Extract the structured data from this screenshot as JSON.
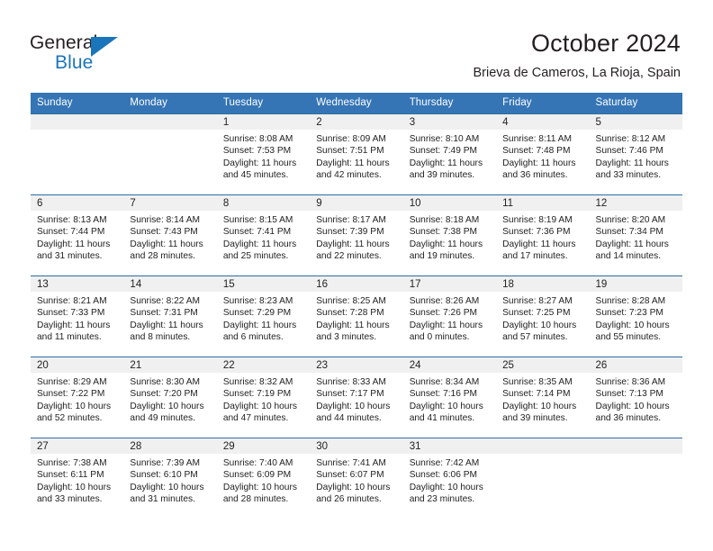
{
  "logo": {
    "word_top": "General",
    "word_bottom": "Blue",
    "triangle_color": "#1b75bb"
  },
  "header": {
    "title": "October 2024",
    "subtitle": "Brieva de Cameros, La Rioja, Spain"
  },
  "colors": {
    "header_row": "#3575b5",
    "row_border": "#2e6da4",
    "daynum_band": "#f0f0f0",
    "text": "#222222"
  },
  "weekday_headers": [
    "Sunday",
    "Monday",
    "Tuesday",
    "Wednesday",
    "Thursday",
    "Friday",
    "Saturday"
  ],
  "labels": {
    "sunrise_prefix": "Sunrise: ",
    "sunset_prefix": "Sunset: ",
    "daylight_prefix": "Daylight: "
  },
  "weeks": [
    [
      {
        "day": "",
        "sunrise": "",
        "sunset": "",
        "daylight_a": "",
        "daylight_b": ""
      },
      {
        "day": "",
        "sunrise": "",
        "sunset": "",
        "daylight_a": "",
        "daylight_b": ""
      },
      {
        "day": "1",
        "sunrise": "Sunrise: 8:08 AM",
        "sunset": "Sunset: 7:53 PM",
        "daylight_a": "Daylight: 11 hours",
        "daylight_b": "and 45 minutes."
      },
      {
        "day": "2",
        "sunrise": "Sunrise: 8:09 AM",
        "sunset": "Sunset: 7:51 PM",
        "daylight_a": "Daylight: 11 hours",
        "daylight_b": "and 42 minutes."
      },
      {
        "day": "3",
        "sunrise": "Sunrise: 8:10 AM",
        "sunset": "Sunset: 7:49 PM",
        "daylight_a": "Daylight: 11 hours",
        "daylight_b": "and 39 minutes."
      },
      {
        "day": "4",
        "sunrise": "Sunrise: 8:11 AM",
        "sunset": "Sunset: 7:48 PM",
        "daylight_a": "Daylight: 11 hours",
        "daylight_b": "and 36 minutes."
      },
      {
        "day": "5",
        "sunrise": "Sunrise: 8:12 AM",
        "sunset": "Sunset: 7:46 PM",
        "daylight_a": "Daylight: 11 hours",
        "daylight_b": "and 33 minutes."
      }
    ],
    [
      {
        "day": "6",
        "sunrise": "Sunrise: 8:13 AM",
        "sunset": "Sunset: 7:44 PM",
        "daylight_a": "Daylight: 11 hours",
        "daylight_b": "and 31 minutes."
      },
      {
        "day": "7",
        "sunrise": "Sunrise: 8:14 AM",
        "sunset": "Sunset: 7:43 PM",
        "daylight_a": "Daylight: 11 hours",
        "daylight_b": "and 28 minutes."
      },
      {
        "day": "8",
        "sunrise": "Sunrise: 8:15 AM",
        "sunset": "Sunset: 7:41 PM",
        "daylight_a": "Daylight: 11 hours",
        "daylight_b": "and 25 minutes."
      },
      {
        "day": "9",
        "sunrise": "Sunrise: 8:17 AM",
        "sunset": "Sunset: 7:39 PM",
        "daylight_a": "Daylight: 11 hours",
        "daylight_b": "and 22 minutes."
      },
      {
        "day": "10",
        "sunrise": "Sunrise: 8:18 AM",
        "sunset": "Sunset: 7:38 PM",
        "daylight_a": "Daylight: 11 hours",
        "daylight_b": "and 19 minutes."
      },
      {
        "day": "11",
        "sunrise": "Sunrise: 8:19 AM",
        "sunset": "Sunset: 7:36 PM",
        "daylight_a": "Daylight: 11 hours",
        "daylight_b": "and 17 minutes."
      },
      {
        "day": "12",
        "sunrise": "Sunrise: 8:20 AM",
        "sunset": "Sunset: 7:34 PM",
        "daylight_a": "Daylight: 11 hours",
        "daylight_b": "and 14 minutes."
      }
    ],
    [
      {
        "day": "13",
        "sunrise": "Sunrise: 8:21 AM",
        "sunset": "Sunset: 7:33 PM",
        "daylight_a": "Daylight: 11 hours",
        "daylight_b": "and 11 minutes."
      },
      {
        "day": "14",
        "sunrise": "Sunrise: 8:22 AM",
        "sunset": "Sunset: 7:31 PM",
        "daylight_a": "Daylight: 11 hours",
        "daylight_b": "and 8 minutes."
      },
      {
        "day": "15",
        "sunrise": "Sunrise: 8:23 AM",
        "sunset": "Sunset: 7:29 PM",
        "daylight_a": "Daylight: 11 hours",
        "daylight_b": "and 6 minutes."
      },
      {
        "day": "16",
        "sunrise": "Sunrise: 8:25 AM",
        "sunset": "Sunset: 7:28 PM",
        "daylight_a": "Daylight: 11 hours",
        "daylight_b": "and 3 minutes."
      },
      {
        "day": "17",
        "sunrise": "Sunrise: 8:26 AM",
        "sunset": "Sunset: 7:26 PM",
        "daylight_a": "Daylight: 11 hours",
        "daylight_b": "and 0 minutes."
      },
      {
        "day": "18",
        "sunrise": "Sunrise: 8:27 AM",
        "sunset": "Sunset: 7:25 PM",
        "daylight_a": "Daylight: 10 hours",
        "daylight_b": "and 57 minutes."
      },
      {
        "day": "19",
        "sunrise": "Sunrise: 8:28 AM",
        "sunset": "Sunset: 7:23 PM",
        "daylight_a": "Daylight: 10 hours",
        "daylight_b": "and 55 minutes."
      }
    ],
    [
      {
        "day": "20",
        "sunrise": "Sunrise: 8:29 AM",
        "sunset": "Sunset: 7:22 PM",
        "daylight_a": "Daylight: 10 hours",
        "daylight_b": "and 52 minutes."
      },
      {
        "day": "21",
        "sunrise": "Sunrise: 8:30 AM",
        "sunset": "Sunset: 7:20 PM",
        "daylight_a": "Daylight: 10 hours",
        "daylight_b": "and 49 minutes."
      },
      {
        "day": "22",
        "sunrise": "Sunrise: 8:32 AM",
        "sunset": "Sunset: 7:19 PM",
        "daylight_a": "Daylight: 10 hours",
        "daylight_b": "and 47 minutes."
      },
      {
        "day": "23",
        "sunrise": "Sunrise: 8:33 AM",
        "sunset": "Sunset: 7:17 PM",
        "daylight_a": "Daylight: 10 hours",
        "daylight_b": "and 44 minutes."
      },
      {
        "day": "24",
        "sunrise": "Sunrise: 8:34 AM",
        "sunset": "Sunset: 7:16 PM",
        "daylight_a": "Daylight: 10 hours",
        "daylight_b": "and 41 minutes."
      },
      {
        "day": "25",
        "sunrise": "Sunrise: 8:35 AM",
        "sunset": "Sunset: 7:14 PM",
        "daylight_a": "Daylight: 10 hours",
        "daylight_b": "and 39 minutes."
      },
      {
        "day": "26",
        "sunrise": "Sunrise: 8:36 AM",
        "sunset": "Sunset: 7:13 PM",
        "daylight_a": "Daylight: 10 hours",
        "daylight_b": "and 36 minutes."
      }
    ],
    [
      {
        "day": "27",
        "sunrise": "Sunrise: 7:38 AM",
        "sunset": "Sunset: 6:11 PM",
        "daylight_a": "Daylight: 10 hours",
        "daylight_b": "and 33 minutes."
      },
      {
        "day": "28",
        "sunrise": "Sunrise: 7:39 AM",
        "sunset": "Sunset: 6:10 PM",
        "daylight_a": "Daylight: 10 hours",
        "daylight_b": "and 31 minutes."
      },
      {
        "day": "29",
        "sunrise": "Sunrise: 7:40 AM",
        "sunset": "Sunset: 6:09 PM",
        "daylight_a": "Daylight: 10 hours",
        "daylight_b": "and 28 minutes."
      },
      {
        "day": "30",
        "sunrise": "Sunrise: 7:41 AM",
        "sunset": "Sunset: 6:07 PM",
        "daylight_a": "Daylight: 10 hours",
        "daylight_b": "and 26 minutes."
      },
      {
        "day": "31",
        "sunrise": "Sunrise: 7:42 AM",
        "sunset": "Sunset: 6:06 PM",
        "daylight_a": "Daylight: 10 hours",
        "daylight_b": "and 23 minutes."
      },
      {
        "day": "",
        "sunrise": "",
        "sunset": "",
        "daylight_a": "",
        "daylight_b": ""
      },
      {
        "day": "",
        "sunrise": "",
        "sunset": "",
        "daylight_a": "",
        "daylight_b": ""
      }
    ]
  ]
}
